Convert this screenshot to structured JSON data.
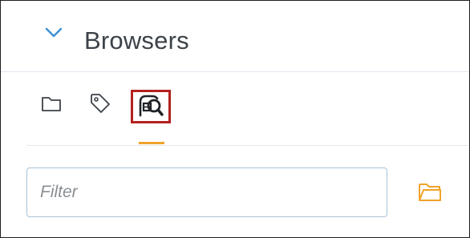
{
  "panel": {
    "title": "Browsers",
    "collapse_icon": "chevron-down-icon"
  },
  "tabs": [
    {
      "icon": "folder-icon",
      "active": false
    },
    {
      "icon": "tag-icon",
      "active": false
    },
    {
      "icon": "search-database-icon",
      "active": true,
      "highlighted": true
    }
  ],
  "filter": {
    "placeholder": "Filter",
    "value": ""
  },
  "browse_button": {
    "icon": "folder-open-icon"
  },
  "colors": {
    "accent": "#f0a32a",
    "chevron": "#3b8fd6",
    "highlight_box": "#b3211e",
    "title_text": "#3c4248",
    "input_border": "#a9c2d6"
  }
}
